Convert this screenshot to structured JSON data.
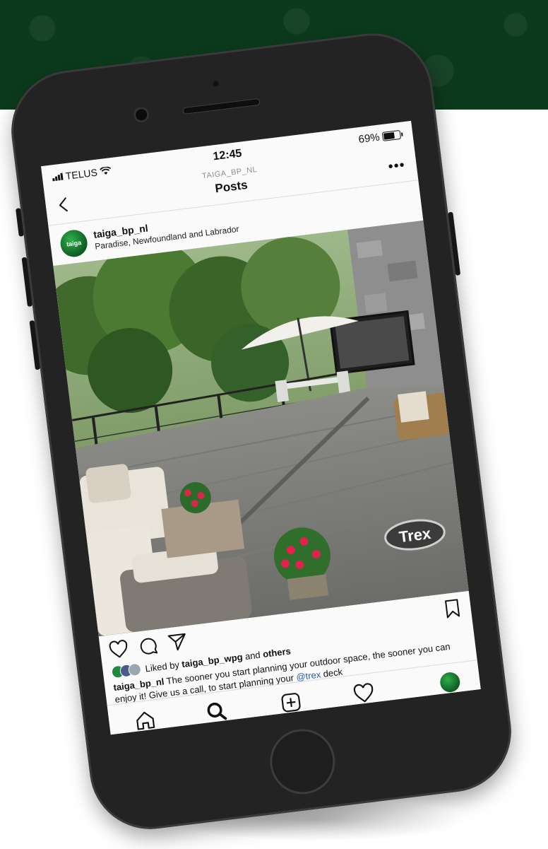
{
  "status_bar": {
    "carrier": "TELUS",
    "time": "12:45",
    "battery": "69%"
  },
  "nav": {
    "account": "TAIGA_BP_NL",
    "title": "Posts"
  },
  "post": {
    "username": "taiga_bp_nl",
    "location": "Paradise, Newfoundland and Labrador",
    "avatar_text": "taiga",
    "watermark": "Trex",
    "likes": {
      "prefix": "Liked by",
      "user": "taiga_bp_wpg",
      "middle": "and",
      "suffix": "others"
    },
    "caption": {
      "user": "taiga_bp_nl",
      "text": "The sooner you start planning your outdoor space, the sooner you can enjoy it! Give us a call, to start planning your",
      "mention": "@trex",
      "tail": "deck"
    }
  },
  "colors": {
    "banner": "#0c3a1c",
    "accent_green": "#1f8a3b",
    "link_blue": "#2a5db0"
  },
  "icons": {
    "back": "chevron-left-icon",
    "more": "more-icon",
    "like": "heart-icon",
    "comment": "comment-icon",
    "share": "send-icon",
    "save": "bookmark-icon",
    "home": "home-icon",
    "search": "search-icon",
    "add": "add-post-icon",
    "activity": "heart-icon"
  }
}
